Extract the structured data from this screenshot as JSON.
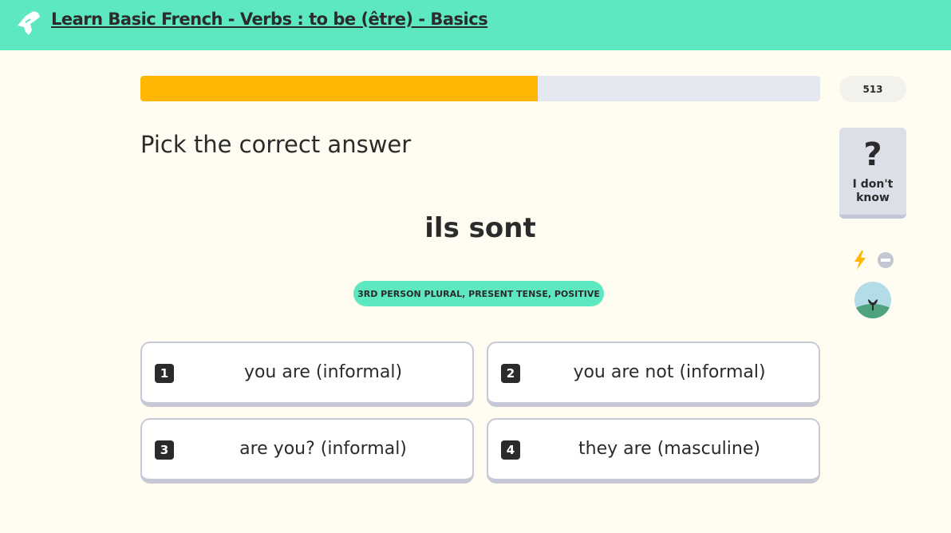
{
  "header": {
    "title": "Learn Basic French - Verbs : to be (être) - Basics",
    "logo_icon": "hand-logo-icon",
    "bg_color": "#5de8c1"
  },
  "progress": {
    "fraction": 0.585,
    "fill_color": "#ffb703",
    "track_color": "#e5e8f0"
  },
  "points": {
    "value": "513"
  },
  "question": {
    "instruction": "Pick the correct answer",
    "prompt": "ils sont",
    "tag": "3RD PERSON PLURAL, PRESENT TENSE, POSITIVE"
  },
  "options": [
    {
      "number": "1",
      "text": "you are (informal)"
    },
    {
      "number": "2",
      "text": "you are not (informal)"
    },
    {
      "number": "3",
      "text": "are you? (informal)"
    },
    {
      "number": "4",
      "text": "they are (masculine)"
    }
  ],
  "sidebar": {
    "dont_know": {
      "icon": "?",
      "label": "I don't know"
    },
    "icons": [
      "lightning-bolt-icon",
      "no-entry-icon",
      "plant-avatar-icon"
    ],
    "accent_color": "#ffb703"
  }
}
